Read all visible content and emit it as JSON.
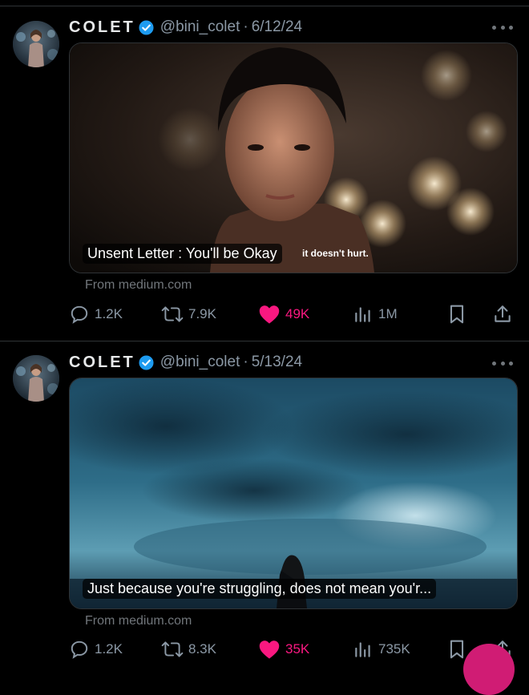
{
  "colors": {
    "background": "#000000",
    "like": "#f91880",
    "verified": "#1d9bf0",
    "muted": "#8b98a5"
  },
  "tweets": [
    {
      "display_name": "COLET",
      "handle": "@bini_colet",
      "date": "6/12/24",
      "card_title": "Unsent Letter : You'll be Okay",
      "card_subtitle": "it doesn't hurt.",
      "card_source": "From medium.com",
      "replies": "1.2K",
      "reposts": "7.9K",
      "likes": "49K",
      "views": "1M",
      "liked": true
    },
    {
      "display_name": "COLET",
      "handle": "@bini_colet",
      "date": "5/13/24",
      "card_title": "Just because you're struggling, does not mean you'r...",
      "card_source": "From medium.com",
      "replies": "1.2K",
      "reposts": "8.3K",
      "likes": "35K",
      "views": "735K",
      "liked": true
    }
  ],
  "icons": {
    "reply": "reply-icon",
    "repost": "repost-icon",
    "like": "heart-icon",
    "views": "views-icon",
    "bookmark": "bookmark-icon",
    "share": "share-icon",
    "verified": "verified-badge-icon",
    "more": "more-options-icon"
  }
}
